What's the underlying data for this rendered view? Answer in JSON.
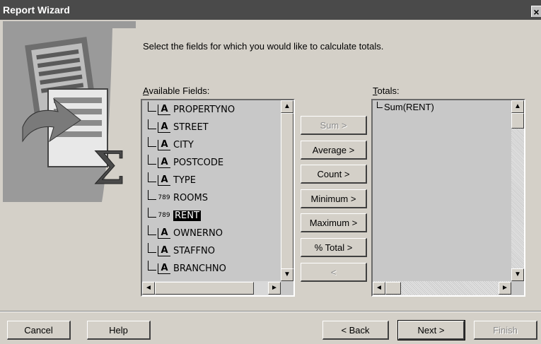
{
  "window": {
    "title": "Report Wizard",
    "close_glyph": "×"
  },
  "instruction": "Select the fields for which you would like to calculate totals.",
  "available": {
    "label_mnemonic": "A",
    "label_rest": "vailable Fields:",
    "fields": [
      {
        "name": "PROPERTYNO",
        "type": "text",
        "icon": "A"
      },
      {
        "name": "STREET",
        "type": "text",
        "icon": "A"
      },
      {
        "name": "CITY",
        "type": "text",
        "icon": "A"
      },
      {
        "name": "POSTCODE",
        "type": "text",
        "icon": "A"
      },
      {
        "name": "TYPE",
        "type": "text",
        "icon": "A"
      },
      {
        "name": "ROOMS",
        "type": "number",
        "icon": "789"
      },
      {
        "name": "RENT",
        "type": "number",
        "icon": "789",
        "selected": true
      },
      {
        "name": "OWNERNO",
        "type": "text",
        "icon": "A"
      },
      {
        "name": "STAFFNO",
        "type": "text",
        "icon": "A"
      },
      {
        "name": "BRANCHNO",
        "type": "text",
        "icon": "A"
      }
    ]
  },
  "totals": {
    "label_mnemonic": "T",
    "label_rest": "otals:",
    "items": [
      "Sum(RENT)"
    ]
  },
  "actions": {
    "sum": "Sum >",
    "average": "Average >",
    "count": "Count >",
    "minimum": "Minimum >",
    "maximum": "Maximum >",
    "pct_total": "% Total >",
    "remove": "<"
  },
  "footer": {
    "cancel": "Cancel",
    "help": "Help",
    "back": "< Back",
    "next": "Next >",
    "finish": "Finish"
  },
  "scroll": {
    "up": "▲",
    "down": "▼",
    "left": "◄",
    "right": "►"
  },
  "colors": {
    "titlebar": "#4a4a4a",
    "dialog": "#d4d0c8",
    "list_bg": "#c8c8c8"
  }
}
